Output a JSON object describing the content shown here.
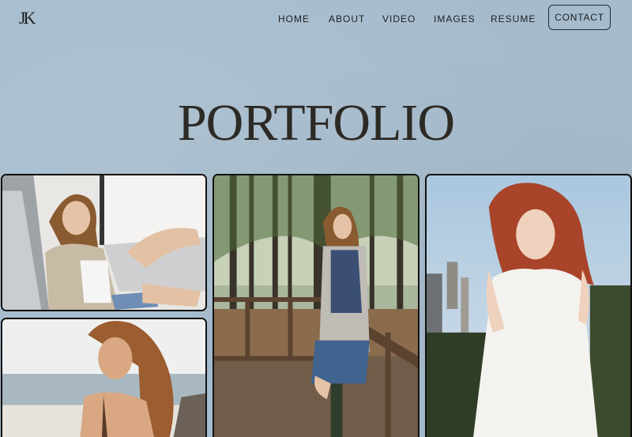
{
  "logo": "JK",
  "nav": {
    "home": "HOME",
    "about": "ABOUT",
    "video": "VIDEO",
    "images": "IMAGES",
    "resume": "RESUME",
    "contact": "CONTACT"
  },
  "page_title": "PORTFOLIO",
  "gallery": [
    {
      "name": "photo-car-model"
    },
    {
      "name": "photo-forest-model"
    },
    {
      "name": "photo-city-model"
    },
    {
      "name": "photo-beach-model"
    }
  ]
}
